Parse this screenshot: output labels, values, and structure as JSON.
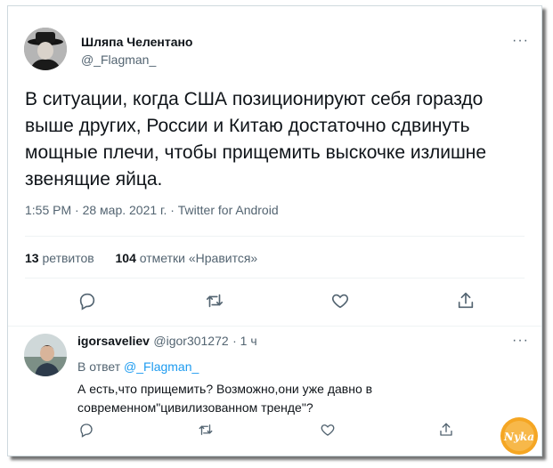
{
  "tweet": {
    "author_name": "Шляпа Челентано",
    "author_handle": "@_Flagman_",
    "text": "В ситуации, когда США позиционируют себя гораздо выше других, России и Китаю достаточно сдвинуть мощные плечи, чтобы прищемить выскочке излишне звенящие яйца.",
    "meta": "1:55 PM · 28 мар. 2021 г. · Twitter for Android",
    "retweets_count": "13",
    "retweets_label": "ретвитов",
    "likes_count": "104",
    "likes_label": "отметки «Нравится»",
    "more": "···"
  },
  "reply": {
    "author_name": "igorsaveliev",
    "author_handle": "@igor301272",
    "time": "· 1 ч",
    "reply_to_label": "В ответ",
    "reply_to_handle": "@_Flagman_",
    "text": "А есть,что прищемить? Возможно,они уже давно в современном\"цивилизованном тренде\"?",
    "more": "···"
  },
  "watermark": {
    "text": "Nyka"
  },
  "icons": [
    "reply-icon",
    "retweet-icon",
    "like-icon",
    "share-icon",
    "more-icon"
  ],
  "colors": {
    "accent": "#1d9bf0",
    "secondary_text": "#536471",
    "divider": "#eff3f4"
  }
}
